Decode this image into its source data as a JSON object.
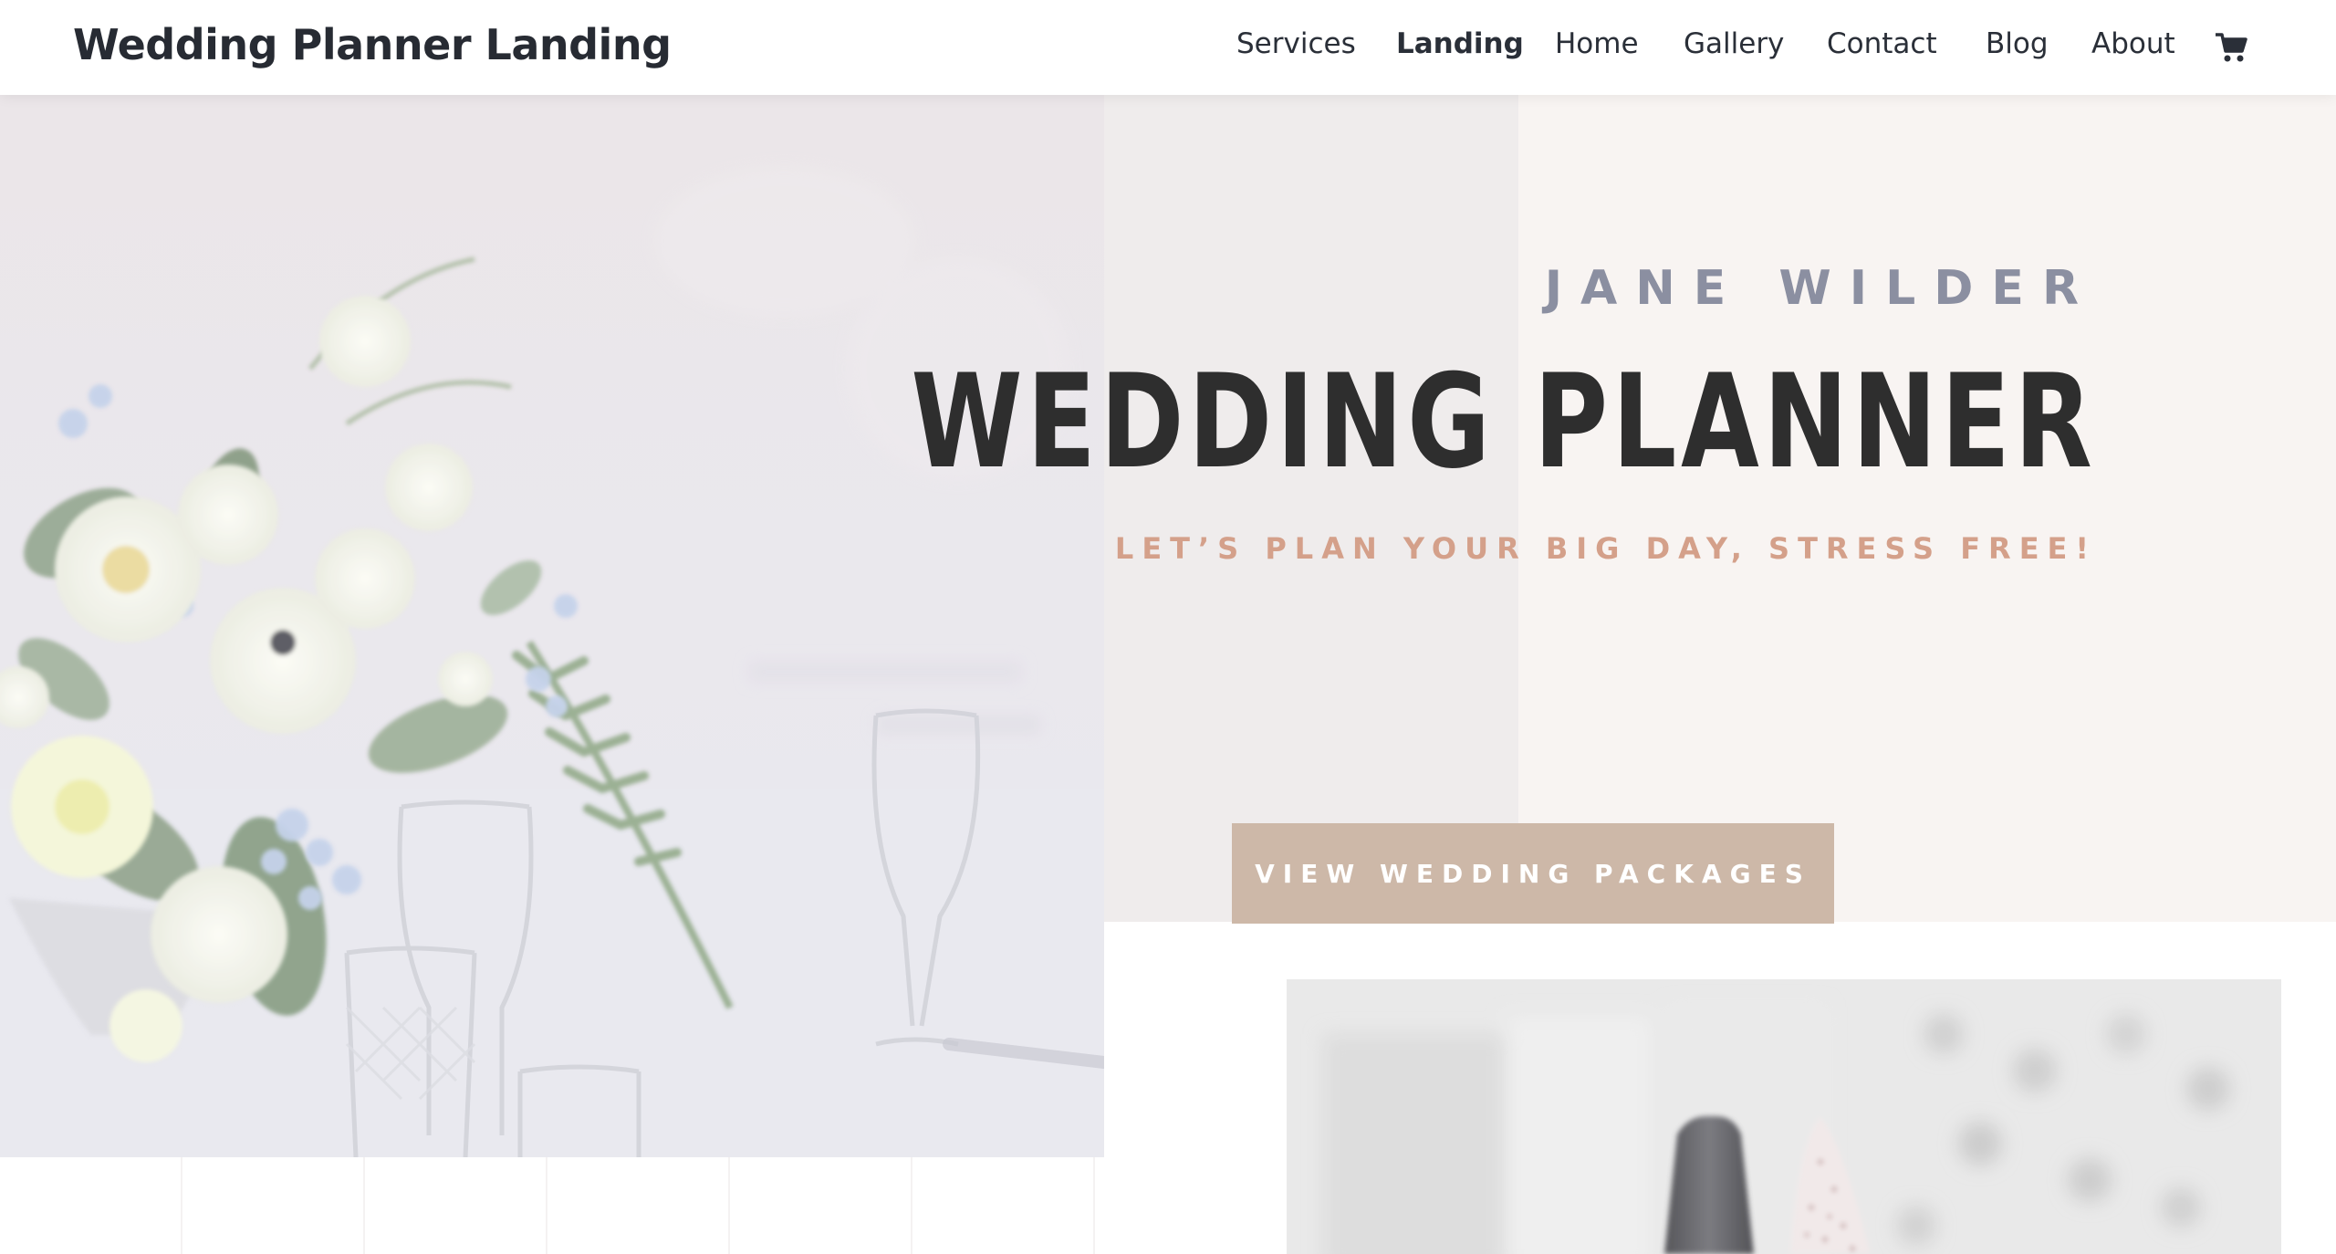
{
  "header": {
    "site_title": "Wedding Planner Landing",
    "cart_icon": "shopping-cart-icon"
  },
  "nav": {
    "items": [
      {
        "label": "Services",
        "active": false
      },
      {
        "label": "Landing",
        "active": true
      },
      {
        "label": "Home",
        "active": false
      },
      {
        "label": "Gallery",
        "active": false
      },
      {
        "label": "Contact",
        "active": false
      },
      {
        "label": "Blog",
        "active": false
      },
      {
        "label": "About",
        "active": false
      }
    ]
  },
  "hero": {
    "eyebrow": "JANE WILDER",
    "headline": "WEDDING PLANNER",
    "subline": "LET’S PLAN YOUR BIG DAY, STRESS FREE!",
    "cta_label": "VIEW WEDDING PACKAGES"
  },
  "colors": {
    "text_dark": "#2e2e2e",
    "eyebrow": "#8b8fa1",
    "accent_text": "#d4a08a",
    "button_bg": "#cdb8a8",
    "hero_bg_left": "#efecec",
    "hero_bg_right": "#f8f4f2"
  }
}
